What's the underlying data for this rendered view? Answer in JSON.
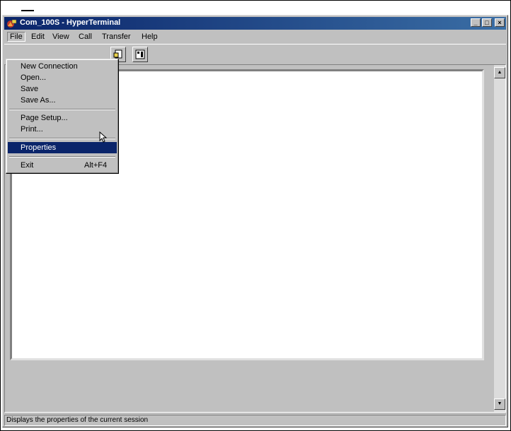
{
  "window": {
    "title": "Com_100S - HyperTerminal",
    "controls": {
      "minimize": "_",
      "maximize": "□",
      "close": "×"
    }
  },
  "menubar": {
    "items": [
      {
        "label": "File"
      },
      {
        "label": "Edit"
      },
      {
        "label": "View"
      },
      {
        "label": "Call"
      },
      {
        "label": "Transfer"
      },
      {
        "label": "Help"
      }
    ]
  },
  "file_menu": {
    "items": [
      {
        "label": "New Connection",
        "shortcut": ""
      },
      {
        "label": "Open...",
        "shortcut": ""
      },
      {
        "label": "Save",
        "shortcut": ""
      },
      {
        "label": "Save As...",
        "shortcut": ""
      },
      {
        "label": "Page Setup...",
        "shortcut": ""
      },
      {
        "label": "Print...",
        "shortcut": ""
      },
      {
        "label": "Properties",
        "shortcut": "",
        "highlighted": true
      },
      {
        "label": "Exit",
        "shortcut": "Alt+F4"
      }
    ]
  },
  "toolbar": {
    "buttons": [
      {
        "icon": "send-icon"
      },
      {
        "icon": "properties-icon"
      }
    ]
  },
  "statusbar": {
    "text": "Displays the properties of the current session"
  },
  "colors": {
    "titlebar_start": "#0a246a",
    "titlebar_end": "#3a6ea5",
    "menu_highlight": "#0a246a",
    "face": "#c0c0c0"
  }
}
